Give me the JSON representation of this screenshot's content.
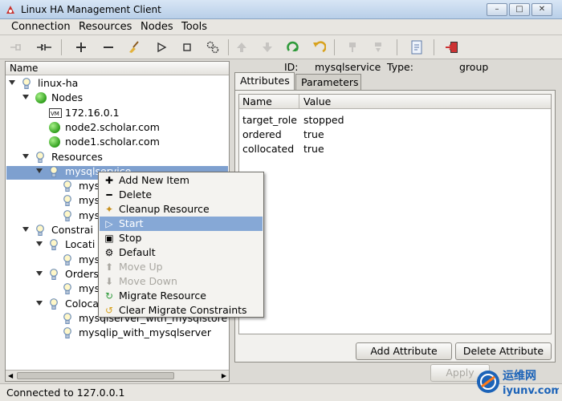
{
  "window": {
    "title": "Linux HA Management Client"
  },
  "menubar": [
    "Connection",
    "Resources",
    "Nodes",
    "Tools"
  ],
  "tree": {
    "header": "Name",
    "rows": [
      {
        "label": "linux-ha",
        "level": 0,
        "icon": "bulb-icon",
        "expanded": true
      },
      {
        "label": "Nodes",
        "level": 1,
        "icon": "green-dot-icon",
        "expanded": true
      },
      {
        "label": "172.16.0.1",
        "level": 2,
        "icon": "vmware-icon"
      },
      {
        "label": "node2.scholar.com",
        "level": 2,
        "icon": "green-dot-icon"
      },
      {
        "label": "node1.scholar.com",
        "level": 2,
        "icon": "green-dot-icon"
      },
      {
        "label": "Resources",
        "level": 1,
        "icon": "bulb-icon",
        "expanded": true
      },
      {
        "label": "mysqlservice",
        "level": 2,
        "icon": "bulb-icon",
        "expanded": true,
        "selected": true
      },
      {
        "label": "mys",
        "level": 3,
        "icon": "bulb-icon"
      },
      {
        "label": "mys",
        "level": 3,
        "icon": "bulb-icon"
      },
      {
        "label": "mys",
        "level": 3,
        "icon": "bulb-icon"
      },
      {
        "label": "Constrai",
        "level": 1,
        "icon": "bulb-icon",
        "expanded": true
      },
      {
        "label": "Locati",
        "level": 2,
        "icon": "bulb-icon",
        "expanded": true
      },
      {
        "label": "mys",
        "level": 3,
        "icon": "bulb-icon"
      },
      {
        "label": "Orders",
        "level": 2,
        "icon": "bulb-icon",
        "expanded": true
      },
      {
        "label": "mys",
        "level": 3,
        "icon": "bulb-icon"
      },
      {
        "label": "Coloca",
        "level": 2,
        "icon": "bulb-icon",
        "expanded": true
      },
      {
        "label": "mysqlserver_with_mysqlstore",
        "level": 3,
        "icon": "bulb-icon"
      },
      {
        "label": "mysqlip_with_mysqlserver",
        "level": 3,
        "icon": "bulb-icon"
      }
    ]
  },
  "details": {
    "id_label": "ID:",
    "id_value": "mysqlservice",
    "type_label": "Type:",
    "type_value": "group",
    "tabs": [
      "Attributes",
      "Parameters"
    ],
    "active_tab": "Attributes",
    "columns": [
      "Name",
      "Value"
    ],
    "rows": [
      {
        "name": "target_role",
        "value": "stopped"
      },
      {
        "name": "ordered",
        "value": "true"
      },
      {
        "name": "collocated",
        "value": "true"
      }
    ],
    "add_button": "Add Attribute",
    "delete_button": "Delete Attribute",
    "apply_button": "Apply"
  },
  "context_menu": [
    {
      "label": "Add New Item",
      "icon": "plus-icon",
      "enabled": true
    },
    {
      "label": "Delete",
      "icon": "minus-icon",
      "enabled": true
    },
    {
      "label": "Cleanup Resource",
      "icon": "broom-icon",
      "enabled": true
    },
    {
      "label": "Start",
      "icon": "play-icon",
      "enabled": true,
      "highlighted": true
    },
    {
      "label": "Stop",
      "icon": "stop-icon",
      "enabled": true
    },
    {
      "label": "Default",
      "icon": "gears-icon",
      "enabled": true
    },
    {
      "label": "Move Up",
      "icon": "arrow-up-icon",
      "enabled": false
    },
    {
      "label": "Move Down",
      "icon": "arrow-down-icon",
      "enabled": false
    },
    {
      "label": "Migrate Resource",
      "icon": "migrate-icon",
      "enabled": true
    },
    {
      "label": "Clear Migrate Constraints",
      "icon": "undo-icon",
      "enabled": true
    }
  ],
  "status": {
    "text": "Connected to 127.0.0.1"
  },
  "watermark": {
    "text": "运维网",
    "domain": "iyunv.com"
  }
}
